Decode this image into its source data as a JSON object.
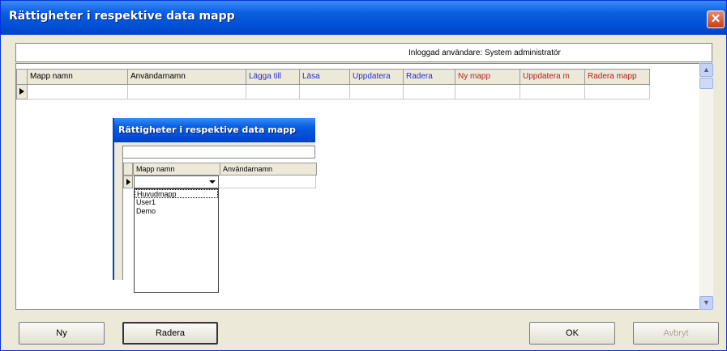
{
  "window": {
    "title": "Rättigheter i respektive data mapp",
    "close_glyph": "✕"
  },
  "info": {
    "logged_in_user": "Inloggad användare: System administratör"
  },
  "grid": {
    "columns": [
      {
        "label": "Mapp namn",
        "color": "#000000"
      },
      {
        "label": "Användarnamn",
        "color": "#000000"
      },
      {
        "label": "Lägga till",
        "color": "#2a2ad0"
      },
      {
        "label": "Läsa",
        "color": "#2a2ad0"
      },
      {
        "label": "Uppdatera",
        "color": "#2a2ad0"
      },
      {
        "label": "Radera",
        "color": "#2a2ad0"
      },
      {
        "label": "Ny mapp",
        "color": "#b22020"
      },
      {
        "label": "Uppdatera m",
        "color": "#b22020"
      },
      {
        "label": "Radera mapp",
        "color": "#b22020"
      }
    ]
  },
  "scrollbar": {
    "up_glyph": "▲",
    "down_glyph": "▼"
  },
  "buttons": {
    "new": "Ny",
    "delete": "Radera",
    "ok": "OK",
    "cancel": "Avbryt"
  },
  "inset": {
    "title": "Rättigheter i respektive data mapp",
    "columns": [
      "Mapp namn",
      "Användarnamn"
    ],
    "dropdown_items": [
      "Huvudmapp",
      "User1",
      "Demo"
    ]
  }
}
